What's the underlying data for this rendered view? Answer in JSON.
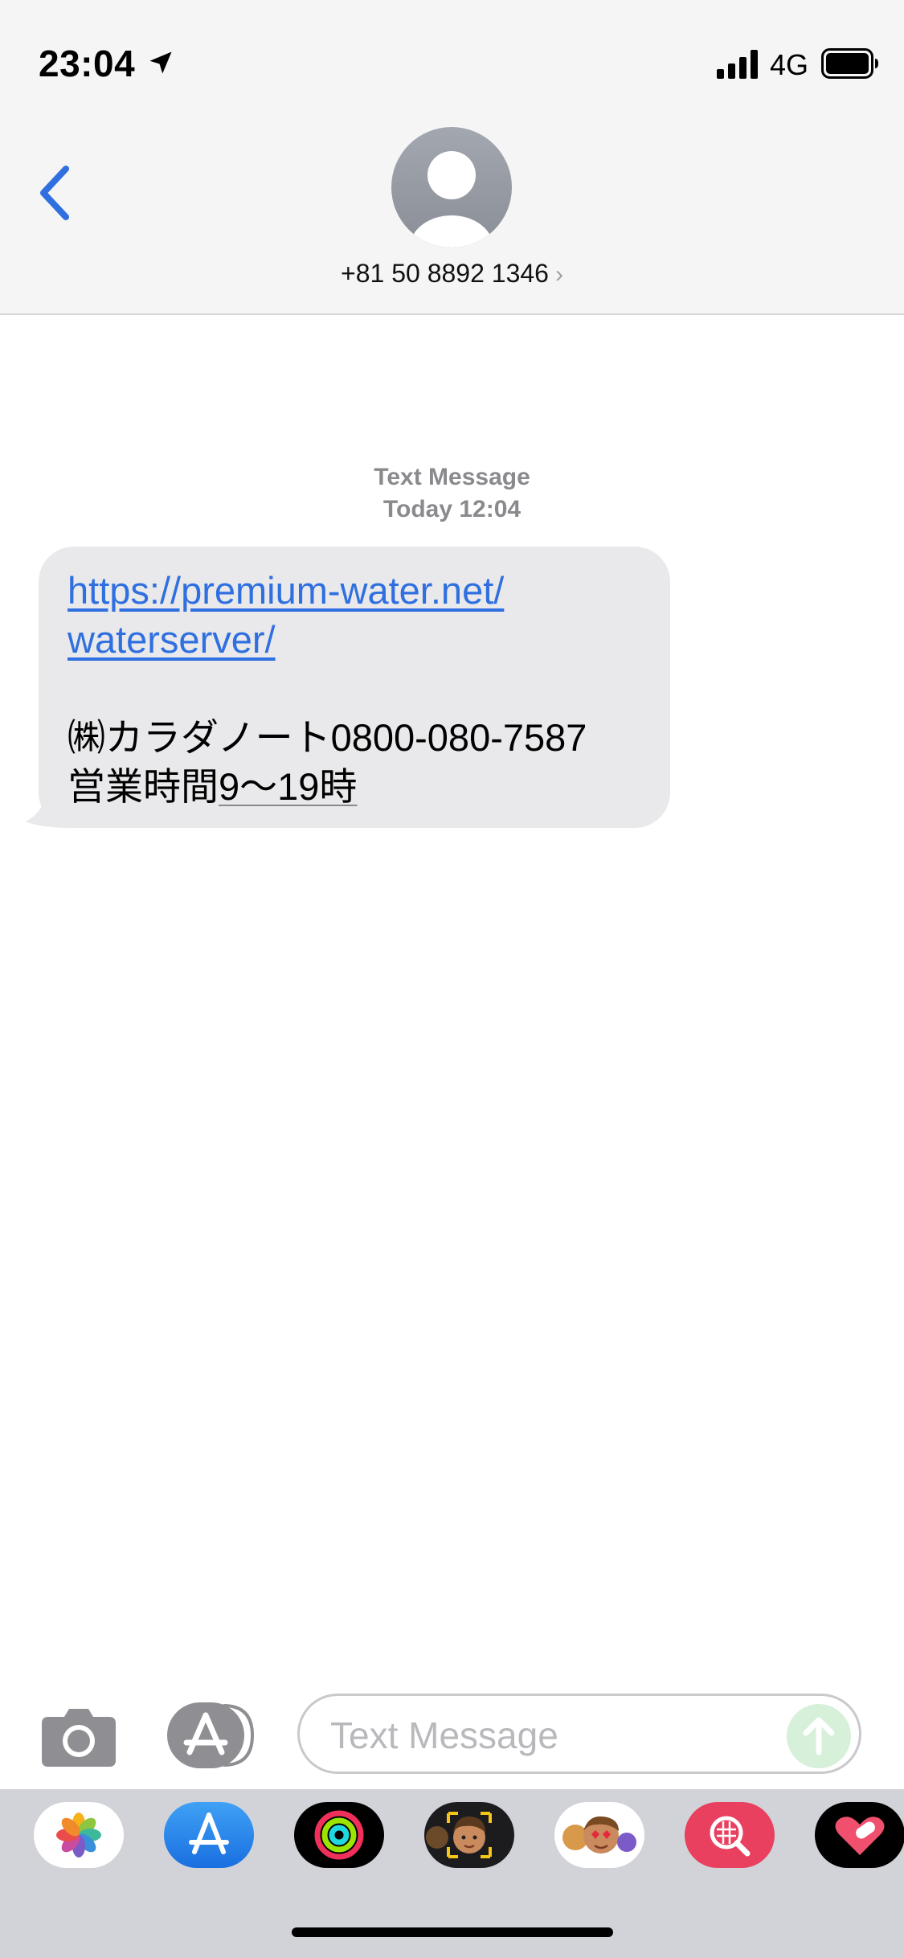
{
  "status_bar": {
    "time": "23:04",
    "network": "4G",
    "icons": [
      "location-arrow-icon",
      "cellular-signal-icon",
      "battery-icon"
    ]
  },
  "header": {
    "contact": "+81 50 8892 1346",
    "chevron": "›",
    "icons": [
      "back-chevron-icon",
      "contact-avatar-icon"
    ]
  },
  "conversation": {
    "service": "Text Message",
    "timestamp": "Today 12:04",
    "message": {
      "link_line1": "https://premium-water.net/",
      "link_line2": "waterserver/",
      "company_line": "㈱カラダノート0800-080-7587",
      "hours_prefix": "営業時間",
      "hours_value": "9〜19時"
    }
  },
  "input_bar": {
    "placeholder": "Text Message",
    "icons": [
      "camera-icon",
      "app-store-icon",
      "send-arrow-icon"
    ]
  },
  "app_drawer": {
    "apps": [
      "photos-icon",
      "app-store-icon",
      "activity-icon",
      "memoji-camera-icon",
      "memoji-stickers-icon",
      "search-images-icon",
      "heart-stickers-icon"
    ]
  },
  "colors": {
    "accent_blue": "#2f6fe0",
    "bubble_gray": "#e9e9eb",
    "bar_background": "#f5f5f5",
    "drawer_background": "#d1d3d9"
  }
}
